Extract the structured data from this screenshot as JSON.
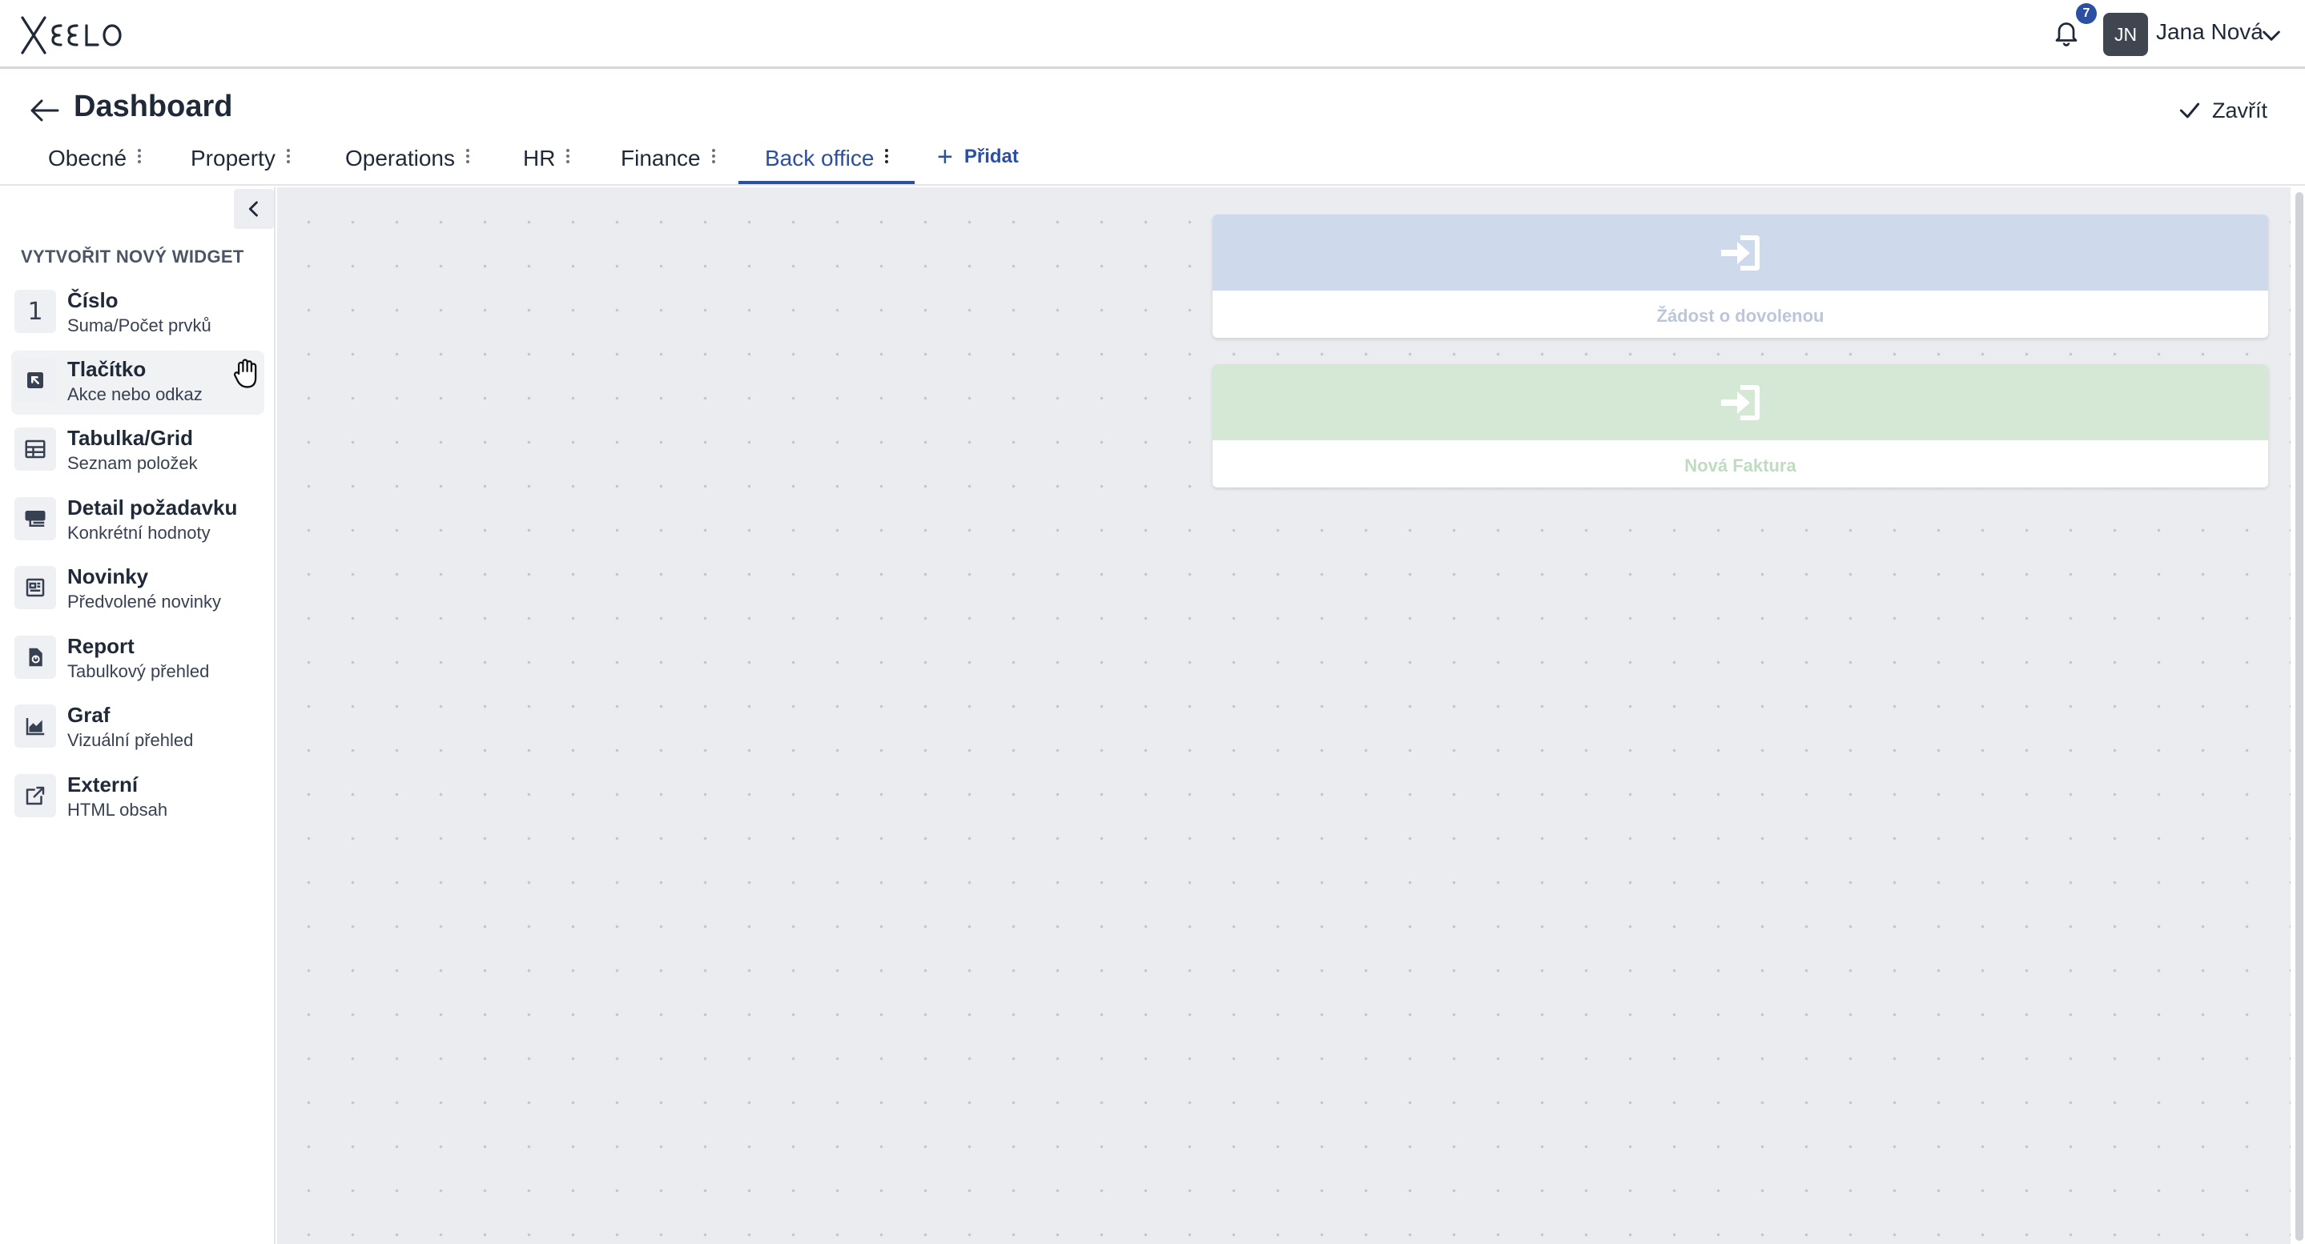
{
  "app": {
    "logo_text": "XEELO",
    "notifications_count": "7",
    "user": {
      "initials": "JN",
      "name": "Jana Nová"
    }
  },
  "header": {
    "title": "Dashboard",
    "close_label": "Zavřít"
  },
  "tabs": [
    {
      "label": "Obecné"
    },
    {
      "label": "Property"
    },
    {
      "label": "Operations"
    },
    {
      "label": "HR"
    },
    {
      "label": "Finance"
    },
    {
      "label": "Back office",
      "active": true
    }
  ],
  "add_tab_label": "Přidat",
  "sidebar": {
    "section_title": "VYTVOŘIT NOVÝ WIDGET",
    "items": [
      {
        "name": "Číslo",
        "subtitle": "Suma/Počet prvků",
        "icon": "number-one-icon",
        "glyph": "1"
      },
      {
        "name": "Tlačítko",
        "subtitle": "Akce nebo odkaz",
        "icon": "button-arrow-icon"
      },
      {
        "name": "Tabulka/Grid",
        "subtitle": "Seznam položek",
        "icon": "table-icon"
      },
      {
        "name": "Detail požadavku",
        "subtitle": "Konkrétní hodnoty",
        "icon": "detail-icon"
      },
      {
        "name": "Novinky",
        "subtitle": "Předvolené novinky",
        "icon": "news-icon"
      },
      {
        "name": "Report",
        "subtitle": "Tabulkový přehled",
        "icon": "report-icon"
      },
      {
        "name": "Graf",
        "subtitle": "Vizuální přehled",
        "icon": "chart-icon"
      },
      {
        "name": "Externí",
        "subtitle": "HTML obsah",
        "icon": "external-link-icon"
      }
    ]
  },
  "canvas": {
    "widgets": [
      {
        "label": "Žádost o dovolenou",
        "band_color": "#cfd9ec",
        "text_color": "#bcc6da",
        "icon": "login-arrow-icon"
      },
      {
        "label": "Nová Faktura",
        "band_color": "#d5e8d6",
        "text_color": "#bfdcc1",
        "icon": "login-arrow-icon"
      }
    ]
  },
  "colors": {
    "accent": "#2b4fa3",
    "canvas_bg": "#eaecef"
  }
}
